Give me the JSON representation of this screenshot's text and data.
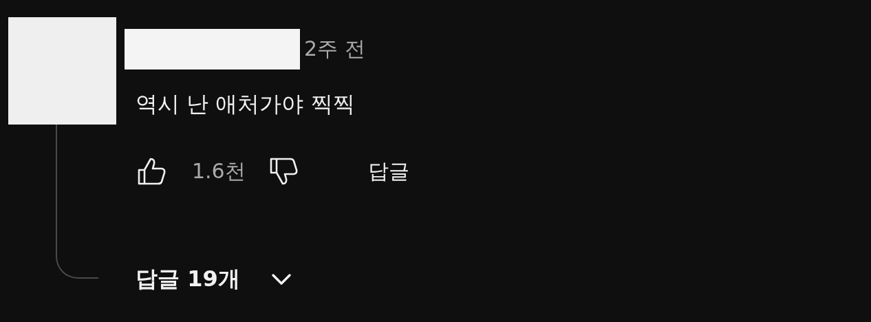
{
  "comment": {
    "time": "2주 전",
    "text": "역시 난 애처가야 찍찍",
    "likes": "1.6천",
    "reply_button": "답글"
  },
  "replies_toggle": {
    "label": "답글 19개",
    "expanded": false
  }
}
